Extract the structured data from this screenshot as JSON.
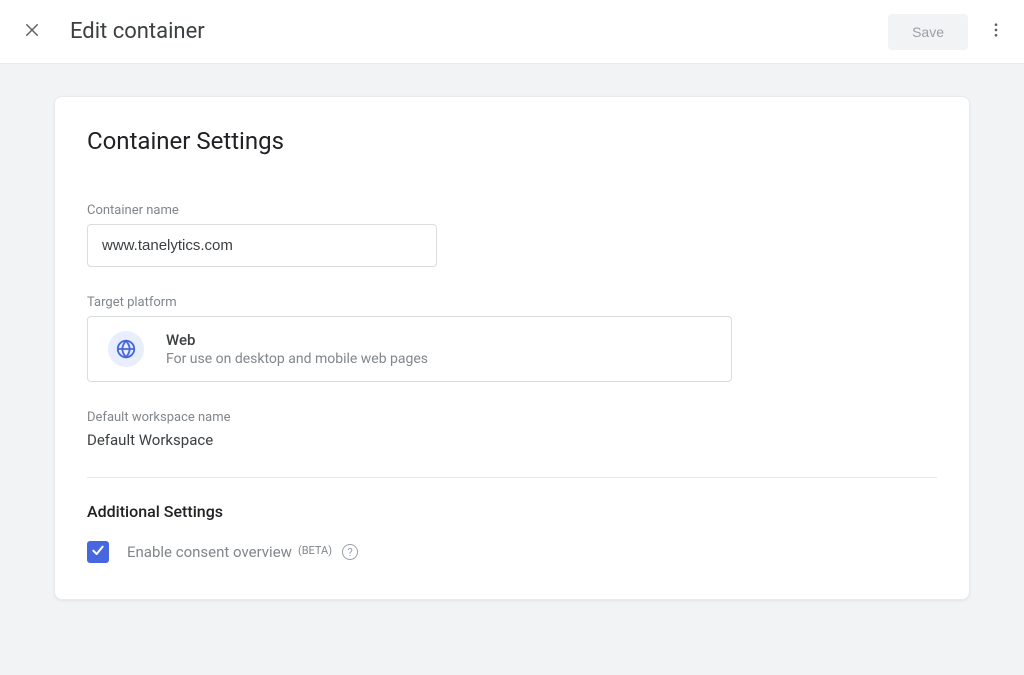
{
  "header": {
    "title": "Edit container",
    "save_label": "Save"
  },
  "card": {
    "title": "Container Settings",
    "container_name_label": "Container name",
    "container_name_value": "www.tanelytics.com",
    "target_platform_label": "Target platform",
    "platform": {
      "title": "Web",
      "description": "For use on desktop and mobile web pages"
    },
    "default_workspace_label": "Default workspace name",
    "default_workspace_value": "Default Workspace",
    "additional_settings_heading": "Additional Settings",
    "consent": {
      "checked": true,
      "label": "Enable consent overview",
      "beta_label": "(BETA)"
    }
  }
}
